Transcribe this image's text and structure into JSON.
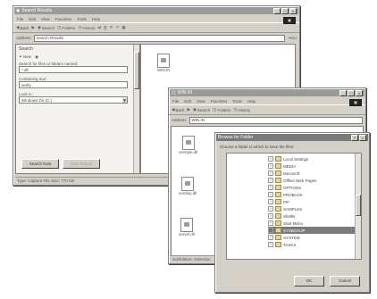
{
  "win1": {
    "title": "Search Results",
    "menu": [
      "File",
      "Edit",
      "View",
      "Favorites",
      "Tools",
      "Help"
    ],
    "toolbar": [
      "Back",
      "Search",
      "Folders",
      "History"
    ],
    "address_label": "Address",
    "address_value": "Search Results",
    "go_label": "Go",
    "search_panel": {
      "header": "Search",
      "new_label": "New",
      "files_label": "Search for files or folders named:",
      "files_value": "*.dll",
      "containing_label": "Containing text:",
      "containing_value": "verify",
      "lookin_label": "Look in:",
      "lookin_value": "Windows Dir (C:)",
      "search_now": "Search Now",
      "stop": "Stop Search"
    },
    "result_file": "WIN.IN",
    "status": "Type: Capture File Size: 770 KB"
  },
  "win2": {
    "title": "WIN.IN",
    "menu": [
      "File",
      "Edit",
      "View",
      "Favorites",
      "Tools",
      "Help"
    ],
    "toolbar": [
      "Back",
      "Search",
      "Folders",
      "History"
    ],
    "address_label": "Address",
    "address_value": "WIN.IN",
    "files": [
      "verstyle.dll",
      "verdisp.dll",
      "servel.dll"
    ],
    "status": "Subfolders: Selection"
  },
  "dialog": {
    "title": "Browse for Folder",
    "instruction": "Choose a folder to which to save the files:",
    "tree": [
      "Local Settings",
      "MEDIA",
      "Microsoft",
      "Offline Web Pages",
      "OPTIONS",
      "PROBACK",
      "PIF",
      "SAMPLES",
      "ShellN",
      "Start Menu",
      "SYSBCKUP",
      "SYSTEM",
      "TASKS"
    ],
    "selected_index": 10,
    "ok": "OK",
    "cancel": "Cancel"
  }
}
